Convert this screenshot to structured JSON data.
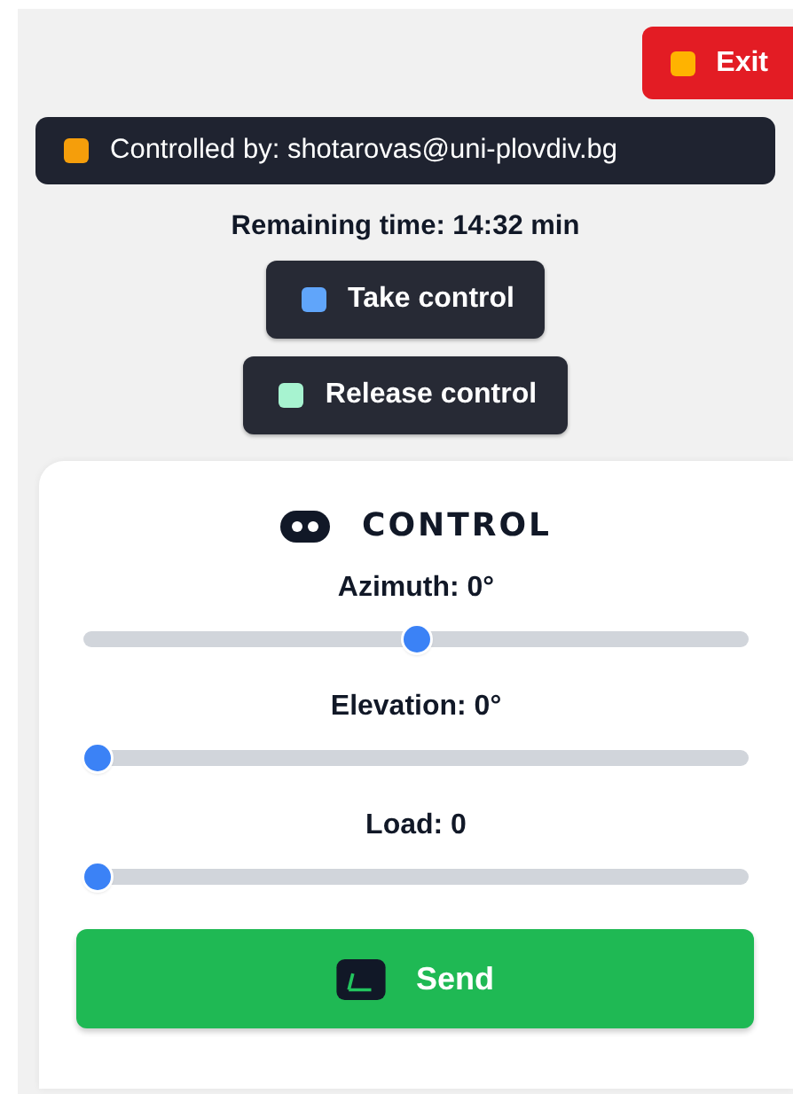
{
  "exit_button": {
    "label": "Exit",
    "color": "#ffb300"
  },
  "status": {
    "label": "Controlled by: shotarovas@uni-plovdiv.bg",
    "color": "#f59e0b"
  },
  "remaining_time": "Remaining time: 14:32 min",
  "actions": [
    {
      "label": "Take control",
      "color": "#60a5fa"
    },
    {
      "label": "Release control",
      "color": "#a7f3d0"
    }
  ],
  "control_panel": {
    "title": "CONTROL",
    "sliders": [
      {
        "label": "Azimuth: 0°",
        "level": 0.5
      },
      {
        "label": "Elevation: 0°",
        "level": 0
      },
      {
        "label": "Load: 0",
        "level": 0
      }
    ],
    "send_button": "Send"
  }
}
